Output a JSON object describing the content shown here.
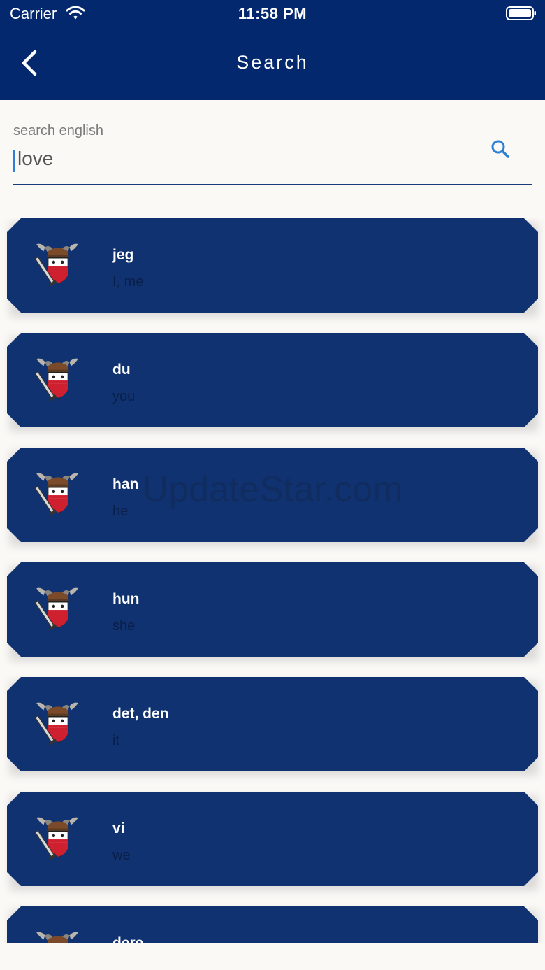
{
  "status_bar": {
    "carrier": "Carrier",
    "time": "11:58 PM"
  },
  "header": {
    "title": "Search"
  },
  "search": {
    "label": "search english",
    "value": "love"
  },
  "results": [
    {
      "word": "jeg",
      "meaning": "I, me"
    },
    {
      "word": "du",
      "meaning": "you"
    },
    {
      "word": "han",
      "meaning": "he"
    },
    {
      "word": "hun",
      "meaning": "she"
    },
    {
      "word": "det, den",
      "meaning": "it"
    },
    {
      "word": "vi",
      "meaning": "we"
    },
    {
      "word": "dere",
      "meaning": ""
    }
  ],
  "watermark": "UpdateStar.com",
  "colors": {
    "header": "#04286e",
    "card": "#103270",
    "accent": "#2e7fd6",
    "background": "#fbf9f6"
  }
}
